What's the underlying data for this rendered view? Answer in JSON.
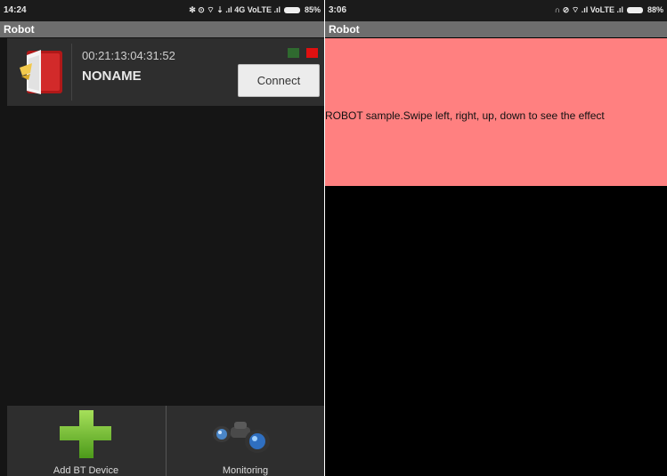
{
  "left": {
    "status": {
      "time": "14:24",
      "icons_text": "✻ ⊙ ⌔ ⇣ .ıl 4G VoLTE .ıl",
      "battery": "85%"
    },
    "title": "Robot",
    "device": {
      "mac": "00:21:13:04:31:52",
      "name": "NONAME",
      "connect_label": "Connect",
      "status_led_colors": [
        "#2f6a2f",
        "#e01010"
      ]
    },
    "bottom_tabs": [
      {
        "label": "Add BT Device",
        "icon": "plus-icon"
      },
      {
        "label": "Monitoring",
        "icon": "binoculars-icon"
      }
    ]
  },
  "right": {
    "status": {
      "time": "3:06",
      "icons_text": "∩ ⊘ ⌔ .ıl VoLTE .ıl",
      "battery": "88%"
    },
    "title": "Robot",
    "message": "ROBOT sample.Swipe left, right, up, down to see the effect",
    "panel_color": "#ff8080"
  }
}
